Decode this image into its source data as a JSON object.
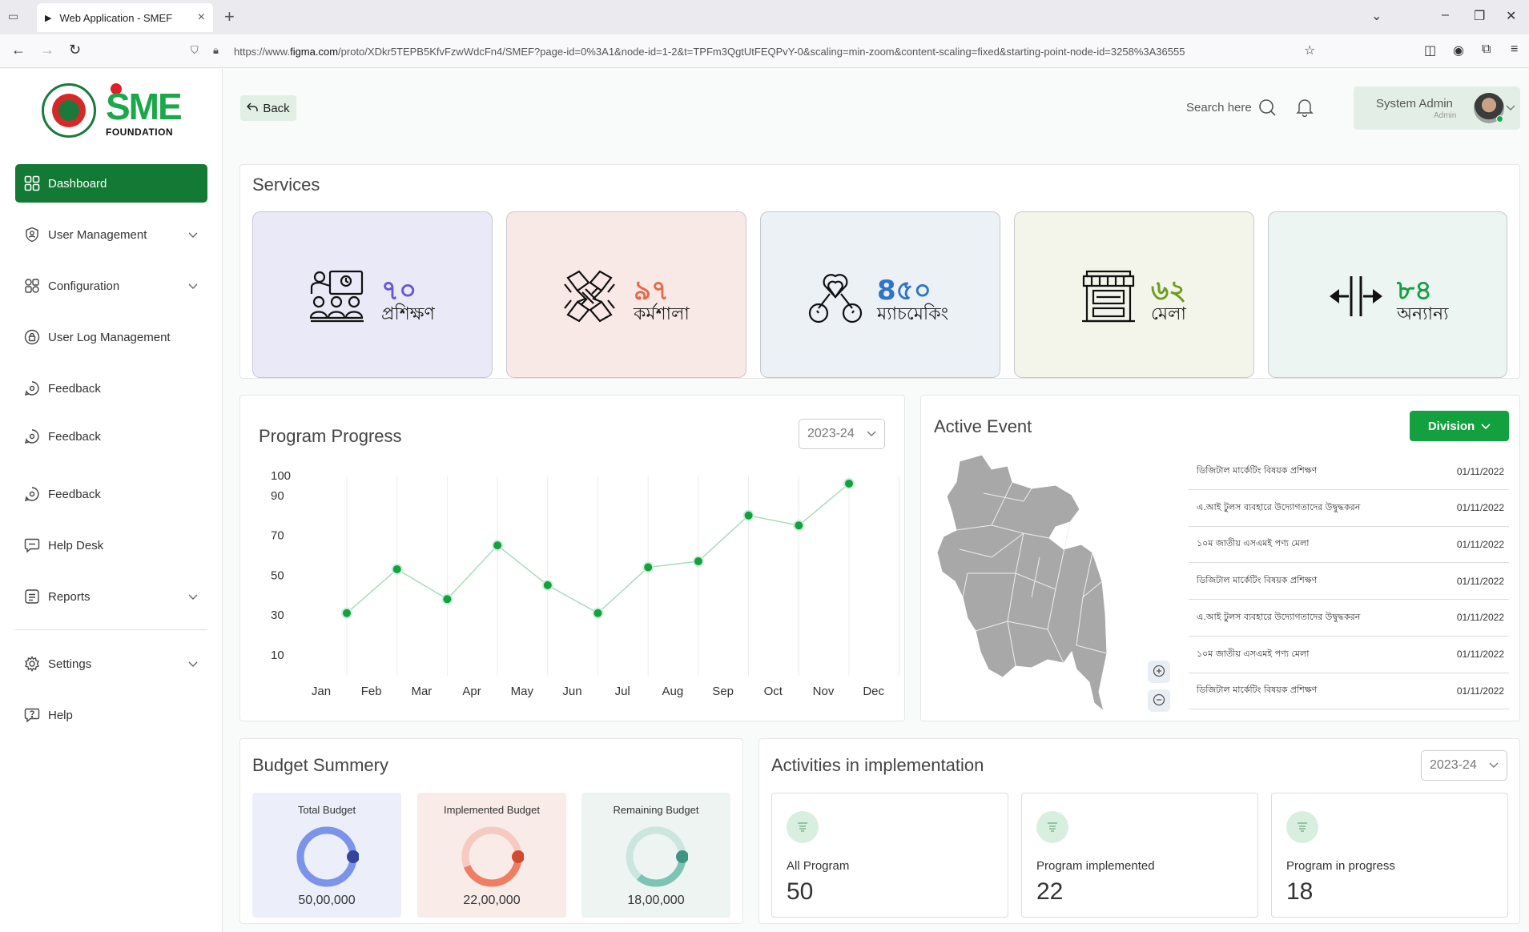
{
  "browser": {
    "tab_title": "Web Application - SMEF",
    "url_prefix": "https://www.",
    "url_host": "figma.com",
    "url_path": "/proto/XDkr5TEPB5KfvFzwWdcFn4/SMEF?page-id=0%3A1&node-id=1-2&t=TPFm3QgtUtFEQPvY-0&scaling=min-zoom&content-scaling=fixed&starting-point-node-id=3258%3A36555"
  },
  "logo": {
    "brand": "SME",
    "sub": "FOUNDATION"
  },
  "sidebar": {
    "items": [
      {
        "label": "Dashboard",
        "icon": "grid-icon",
        "active": true
      },
      {
        "label": "User Management",
        "icon": "user-shield-icon",
        "chevron": true
      },
      {
        "label": "Configuration",
        "icon": "config-icon",
        "chevron": true
      },
      {
        "label": "User Log Management",
        "icon": "lock-circle-icon"
      },
      {
        "label": "Feedback",
        "icon": "feedback-icon"
      },
      {
        "label": "Feedback",
        "icon": "feedback-icon"
      },
      {
        "label": "Feedback",
        "icon": "feedback-icon"
      },
      {
        "label": "Help Desk",
        "icon": "chat-icon"
      },
      {
        "label": "Reports",
        "icon": "report-icon",
        "chevron": true
      },
      {
        "label": "Settings",
        "icon": "gear-icon",
        "chevron": true
      },
      {
        "label": "Help",
        "icon": "help-icon"
      }
    ]
  },
  "topbar": {
    "back_label": "Back",
    "search_label": "Search here",
    "user_name": "System Admin",
    "user_role": "Admin"
  },
  "services": {
    "title": "Services",
    "cards": [
      {
        "num": "৭০",
        "label": "প্রশিক্ষণ",
        "bg": "#eae9f7",
        "color": "#6a55d8",
        "icon": "training-icon"
      },
      {
        "num": "৯৭",
        "label": "কর্মশালা",
        "bg": "#f9e9e6",
        "color": "#e66a4a",
        "icon": "workshop-icon"
      },
      {
        "num": "8৫০",
        "label": "ম্যাচমেকিং",
        "bg": "#ecf1f6",
        "color": "#2f74c9",
        "icon": "matchmaking-icon"
      },
      {
        "num": "৬২",
        "label": "মেলা",
        "bg": "#f3f5ea",
        "color": "#6f9c1e",
        "icon": "fair-stall-icon"
      },
      {
        "num": "৮৪",
        "label": "অন্যান্য",
        "bg": "#ecf5f1",
        "color": "#13a03f",
        "icon": "others-arrows-icon"
      }
    ]
  },
  "program_progress": {
    "title": "Program Progress",
    "year": "2023-24"
  },
  "chart_data": {
    "type": "line",
    "title": "Program Progress",
    "categories": [
      "Jan",
      "Feb",
      "Mar",
      "Apr",
      "May",
      "Jun",
      "Jul",
      "Aug",
      "Sep",
      "Oct",
      "Nov",
      "Dec"
    ],
    "values": [
      31,
      53,
      38,
      65,
      45,
      31,
      54,
      57,
      80,
      75,
      96,
      null
    ],
    "yticks": [
      "100",
      "90",
      "70",
      "50",
      "30",
      "10"
    ],
    "ylim": [
      10,
      100
    ],
    "grid": "vertical",
    "color": "#13a03f"
  },
  "active_event": {
    "title": "Active Event",
    "filter_label": "Division",
    "events": [
      {
        "title": "ডিজিটাল মার্কেটিং বিষয়ক প্রশিক্ষণ",
        "date": "01/11/2022"
      },
      {
        "title": "এ.আই টুলস ব্যবহারে উদ্যোগতাদের উদ্বুদ্ধকরন",
        "date": "01/11/2022"
      },
      {
        "title": "১০ম জাতীয় এসএমই পণ্য মেলা",
        "date": "01/11/2022"
      },
      {
        "title": "ডিজিটাল মার্কেটিং বিষয়ক প্রশিক্ষণ",
        "date": "01/11/2022"
      },
      {
        "title": "এ.আই টুলস ব্যবহারে উদ্যোগতাদের উদ্বুদ্ধকরন",
        "date": "01/11/2022"
      },
      {
        "title": "১০ম জাতীয় এসএমই পণ্য মেলা",
        "date": "01/11/2022"
      },
      {
        "title": "ডিজিটাল মার্কেটিং বিষয়ক প্রশিক্ষণ",
        "date": "01/11/2022"
      }
    ]
  },
  "budget": {
    "title": "Budget Summery",
    "cards": [
      {
        "label": "Total Budget",
        "value": "50,00,000",
        "bg": "#eceff9",
        "color": "#7b93e8",
        "dot": "#34449a",
        "fill": 1.0
      },
      {
        "label": "Implemented Budget",
        "value": "22,00,000",
        "bg": "#f9ebe8",
        "color": "#ef7e65",
        "dot": "#cf4a2f",
        "fill": 0.44
      },
      {
        "label": "Remaining Budget",
        "value": "18,00,000",
        "bg": "#eef4f2",
        "color": "#7cc4b4",
        "dot": "#3f9483",
        "fill": 0.36
      }
    ]
  },
  "activities": {
    "title": "Activities in implementation",
    "year": "2023-24",
    "cards": [
      {
        "label": "All Program",
        "value": "50"
      },
      {
        "label": "Program implemented",
        "value": "22"
      },
      {
        "label": "Program in progress",
        "value": "18"
      }
    ]
  }
}
